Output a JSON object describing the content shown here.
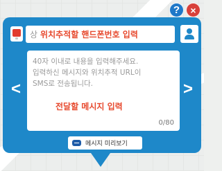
{
  "map": {
    "label": ""
  },
  "top_buttons": {
    "help": "?",
    "close": "×"
  },
  "phone": {
    "prefix": "상",
    "overlay_label": "위치추적할 핸드폰번호 입력"
  },
  "message": {
    "placeholder": "40자 이내로 내용을 입력해주세요.\n입력하신 메시지와 위치추적 URL이\nSMS로 전송됩니다.",
    "overlay_label": "전달할 메시지 입력",
    "char_count": "0/80"
  },
  "nav": {
    "prev": "<",
    "next": ">"
  },
  "preview_button": {
    "label": "메시지 미리보기"
  },
  "colors": {
    "popup_blue": "#1e88c9",
    "help_blue": "#1f78c8",
    "close_red": "#d8403a",
    "overlay_red": "#e74a2f"
  },
  "icons": {
    "phone": "phone-icon",
    "contact": "contact-icon",
    "message": "message-icon"
  }
}
